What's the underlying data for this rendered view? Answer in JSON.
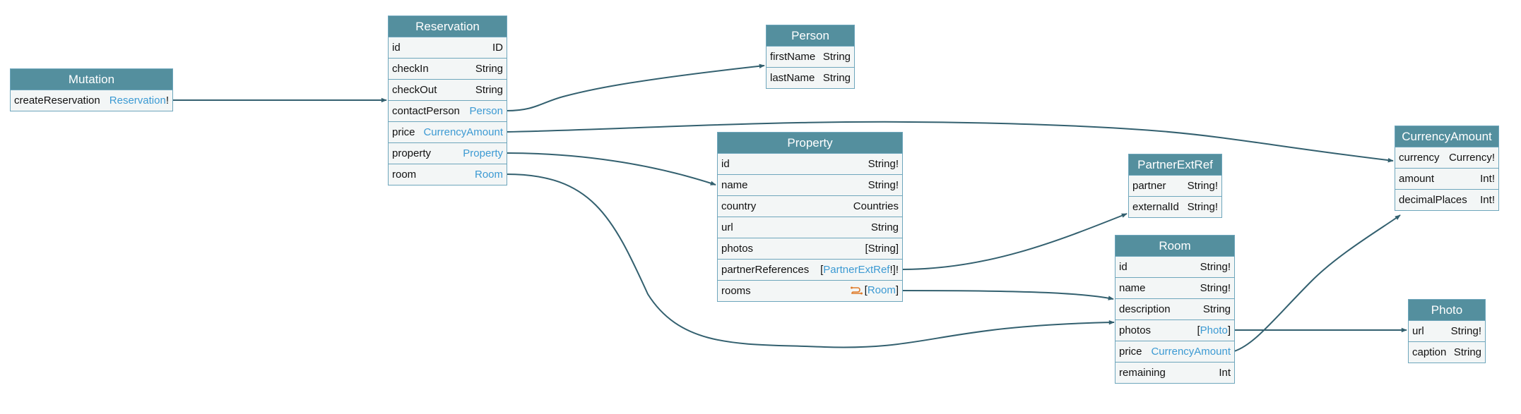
{
  "colors": {
    "header_bg": "#548f9e",
    "body_bg": "#f3f6f6",
    "border": "#6ea6bc",
    "link_type": "#3c9ad3",
    "edge": "#33606f",
    "relay_icon": "#e07b2a"
  },
  "nodes": {
    "mutation": {
      "title": "Mutation",
      "fields": [
        {
          "name": "createReservation",
          "pre": "",
          "type": "Reservation",
          "post": "!",
          "link": true
        }
      ]
    },
    "reservation": {
      "title": "Reservation",
      "fields": [
        {
          "name": "id",
          "pre": "",
          "type": "ID",
          "post": "",
          "link": false
        },
        {
          "name": "checkIn",
          "pre": "",
          "type": "String",
          "post": "",
          "link": false
        },
        {
          "name": "checkOut",
          "pre": "",
          "type": "String",
          "post": "",
          "link": false
        },
        {
          "name": "contactPerson",
          "pre": "",
          "type": "Person",
          "post": "",
          "link": true
        },
        {
          "name": "price",
          "pre": "",
          "type": "CurrencyAmount",
          "post": "",
          "link": true
        },
        {
          "name": "property",
          "pre": "",
          "type": "Property",
          "post": "",
          "link": true
        },
        {
          "name": "room",
          "pre": "",
          "type": "Room",
          "post": "",
          "link": true
        }
      ]
    },
    "person": {
      "title": "Person",
      "fields": [
        {
          "name": "firstName",
          "pre": "",
          "type": "String",
          "post": "",
          "link": false
        },
        {
          "name": "lastName",
          "pre": "",
          "type": "String",
          "post": "",
          "link": false
        }
      ]
    },
    "property": {
      "title": "Property",
      "fields": [
        {
          "name": "id",
          "pre": "",
          "type": "String!",
          "post": "",
          "link": false
        },
        {
          "name": "name",
          "pre": "",
          "type": "String!",
          "post": "",
          "link": false
        },
        {
          "name": "country",
          "pre": "",
          "type": "Countries",
          "post": "",
          "link": false
        },
        {
          "name": "url",
          "pre": "",
          "type": "String",
          "post": "",
          "link": false
        },
        {
          "name": "photos",
          "pre": "",
          "type": "[String]",
          "post": "",
          "link": false
        },
        {
          "name": "partnerReferences",
          "pre": "[",
          "type": "PartnerExtRef",
          "post": "!]!",
          "link": true
        },
        {
          "name": "rooms",
          "pre": "[",
          "type": "Room",
          "post": "]",
          "link": true,
          "icon": "relay-connection-icon"
        }
      ]
    },
    "partnerExtRef": {
      "title": "PartnerExtRef",
      "fields": [
        {
          "name": "partner",
          "pre": "",
          "type": "String!",
          "post": "",
          "link": false
        },
        {
          "name": "externalId",
          "pre": "",
          "type": "String!",
          "post": "",
          "link": false
        }
      ]
    },
    "room": {
      "title": "Room",
      "fields": [
        {
          "name": "id",
          "pre": "",
          "type": "String!",
          "post": "",
          "link": false
        },
        {
          "name": "name",
          "pre": "",
          "type": "String!",
          "post": "",
          "link": false
        },
        {
          "name": "description",
          "pre": "",
          "type": "String",
          "post": "",
          "link": false
        },
        {
          "name": "photos",
          "pre": "[",
          "type": "Photo",
          "post": "]",
          "link": true
        },
        {
          "name": "price",
          "pre": "",
          "type": "CurrencyAmount",
          "post": "",
          "link": true
        },
        {
          "name": "remaining",
          "pre": "",
          "type": "Int",
          "post": "",
          "link": false
        }
      ]
    },
    "currencyAmount": {
      "title": "CurrencyAmount",
      "fields": [
        {
          "name": "currency",
          "pre": "",
          "type": "Currency!",
          "post": "",
          "link": false
        },
        {
          "name": "amount",
          "pre": "",
          "type": "Int!",
          "post": "",
          "link": false
        },
        {
          "name": "decimalPlaces",
          "pre": "",
          "type": "Int!",
          "post": "",
          "link": false
        }
      ]
    },
    "photo": {
      "title": "Photo",
      "fields": [
        {
          "name": "url",
          "pre": "",
          "type": "String!",
          "post": "",
          "link": false
        },
        {
          "name": "caption",
          "pre": "",
          "type": "String",
          "post": "",
          "link": false
        }
      ]
    }
  },
  "edges": [
    {
      "from": "mutation.createReservation",
      "to": "reservation"
    },
    {
      "from": "reservation.contactPerson",
      "to": "person"
    },
    {
      "from": "reservation.price",
      "to": "currencyAmount"
    },
    {
      "from": "reservation.property",
      "to": "property"
    },
    {
      "from": "reservation.room",
      "to": "room"
    },
    {
      "from": "property.partnerReferences",
      "to": "partnerExtRef"
    },
    {
      "from": "property.rooms",
      "to": "room"
    },
    {
      "from": "room.photos",
      "to": "photo"
    },
    {
      "from": "room.price",
      "to": "currencyAmount"
    }
  ]
}
